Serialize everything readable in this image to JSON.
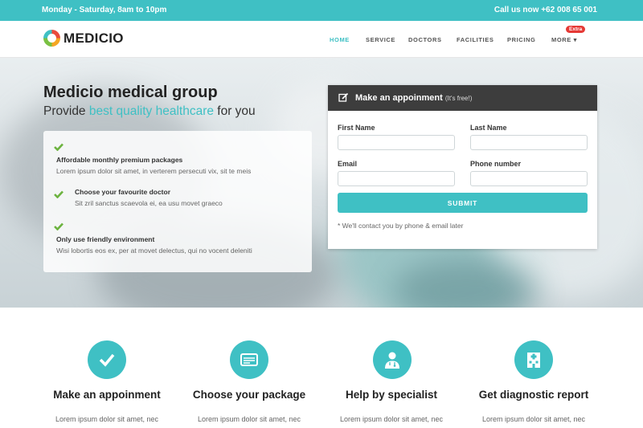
{
  "topbar": {
    "hours": "Monday - Saturday, 8am to 10pm",
    "phone": "Call us now +62 008 65 001"
  },
  "brand": {
    "name": "MEDICIO"
  },
  "nav": {
    "items": [
      {
        "label": "HOME",
        "active": true
      },
      {
        "label": "SERVICE"
      },
      {
        "label": "DOCTORS"
      },
      {
        "label": "FACILITIES"
      },
      {
        "label": "PRICING"
      },
      {
        "label": "MORE ▾"
      }
    ],
    "badge": "Extra"
  },
  "hero": {
    "title": "Medicio medical group",
    "subtitle_pre": "Provide ",
    "subtitle_highlight": "best quality healthcare",
    "subtitle_post": " for you",
    "features": [
      {
        "title": "Affordable monthly premium packages",
        "desc": "Lorem ipsum dolor sit amet, in verterem persecuti vix, sit te meis"
      },
      {
        "title": "Choose your favourite doctor",
        "desc": "Sit zril sanctus scaevola ei, ea usu movet graeco"
      },
      {
        "title": "Only use friendly environment",
        "desc": "Wisi lobortis eos ex, per at movet delectus, qui no vocent deleniti"
      }
    ]
  },
  "appointment": {
    "title": "Make an appoinment",
    "subtitle": "(It's free!)",
    "fields": {
      "first_name": {
        "label": "First Name",
        "value": ""
      },
      "last_name": {
        "label": "Last Name",
        "value": ""
      },
      "email": {
        "label": "Email",
        "value": ""
      },
      "phone": {
        "label": "Phone number",
        "value": ""
      }
    },
    "submit_label": "SUBMIT",
    "note": "* We'll contact you by phone & email later"
  },
  "services": [
    {
      "icon": "check-icon",
      "title": "Make an appoinment",
      "text": "Lorem ipsum dolor sit amet, nec"
    },
    {
      "icon": "card-icon",
      "title": "Choose your package",
      "text": "Lorem ipsum dolor sit amet, nec"
    },
    {
      "icon": "doctor-icon",
      "title": "Help by specialist",
      "text": "Lorem ipsum dolor sit amet, nec"
    },
    {
      "icon": "hospital-icon",
      "title": "Get diagnostic report",
      "text": "Lorem ipsum dolor sit amet, nec"
    }
  ],
  "colors": {
    "accent": "#3fc0c4",
    "dark_header": "#3d3d3d",
    "check_green": "#6cb33f",
    "badge_red": "#e53935"
  }
}
